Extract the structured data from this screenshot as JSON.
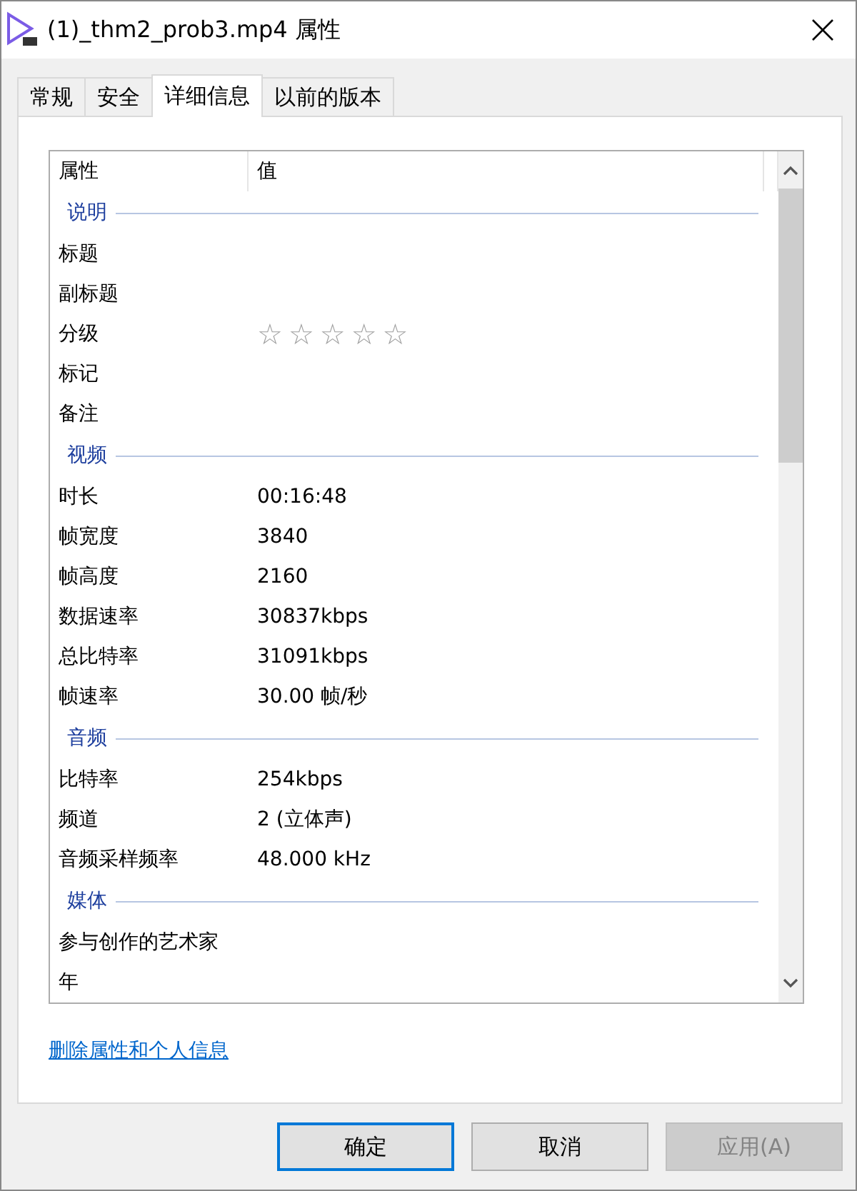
{
  "window": {
    "title": "(1)_thm2_prob3.mp4 属性"
  },
  "tabs": [
    {
      "label": "常规",
      "selected": false
    },
    {
      "label": "安全",
      "selected": false
    },
    {
      "label": "详细信息",
      "selected": true
    },
    {
      "label": "以前的版本",
      "selected": false
    }
  ],
  "list": {
    "columns": [
      "属性",
      "值"
    ],
    "groups": [
      {
        "title": "说明",
        "rows": [
          {
            "name": "标题"
          },
          {
            "name": "副标题"
          },
          {
            "name": "分级",
            "kind": "rating",
            "stars": 0
          },
          {
            "name": "标记"
          },
          {
            "name": "备注"
          }
        ]
      },
      {
        "title": "视频",
        "rows": [
          {
            "name": "时长",
            "value": "00:16:48"
          },
          {
            "name": "帧宽度",
            "value": "3840"
          },
          {
            "name": "帧高度",
            "value": "2160"
          },
          {
            "name": "数据速率",
            "value": "30837kbps"
          },
          {
            "name": "总比特率",
            "value": "31091kbps"
          },
          {
            "name": "帧速率",
            "value": "30.00 帧/秒"
          }
        ]
      },
      {
        "title": "音频",
        "rows": [
          {
            "name": "比特率",
            "value": "254kbps"
          },
          {
            "name": "频道",
            "value": "2 (立体声)"
          },
          {
            "name": "音频采样频率",
            "value": "48.000 kHz"
          }
        ]
      },
      {
        "title": "媒体",
        "rows": [
          {
            "name": "参与创作的艺术家"
          },
          {
            "name": "年"
          }
        ]
      }
    ]
  },
  "link": "删除属性和个人信息",
  "buttons": [
    {
      "label": "确定",
      "default": true,
      "disabled": false
    },
    {
      "label": "取消",
      "default": false,
      "disabled": false
    },
    {
      "label": "应用(A)",
      "default": false,
      "disabled": true
    }
  ]
}
